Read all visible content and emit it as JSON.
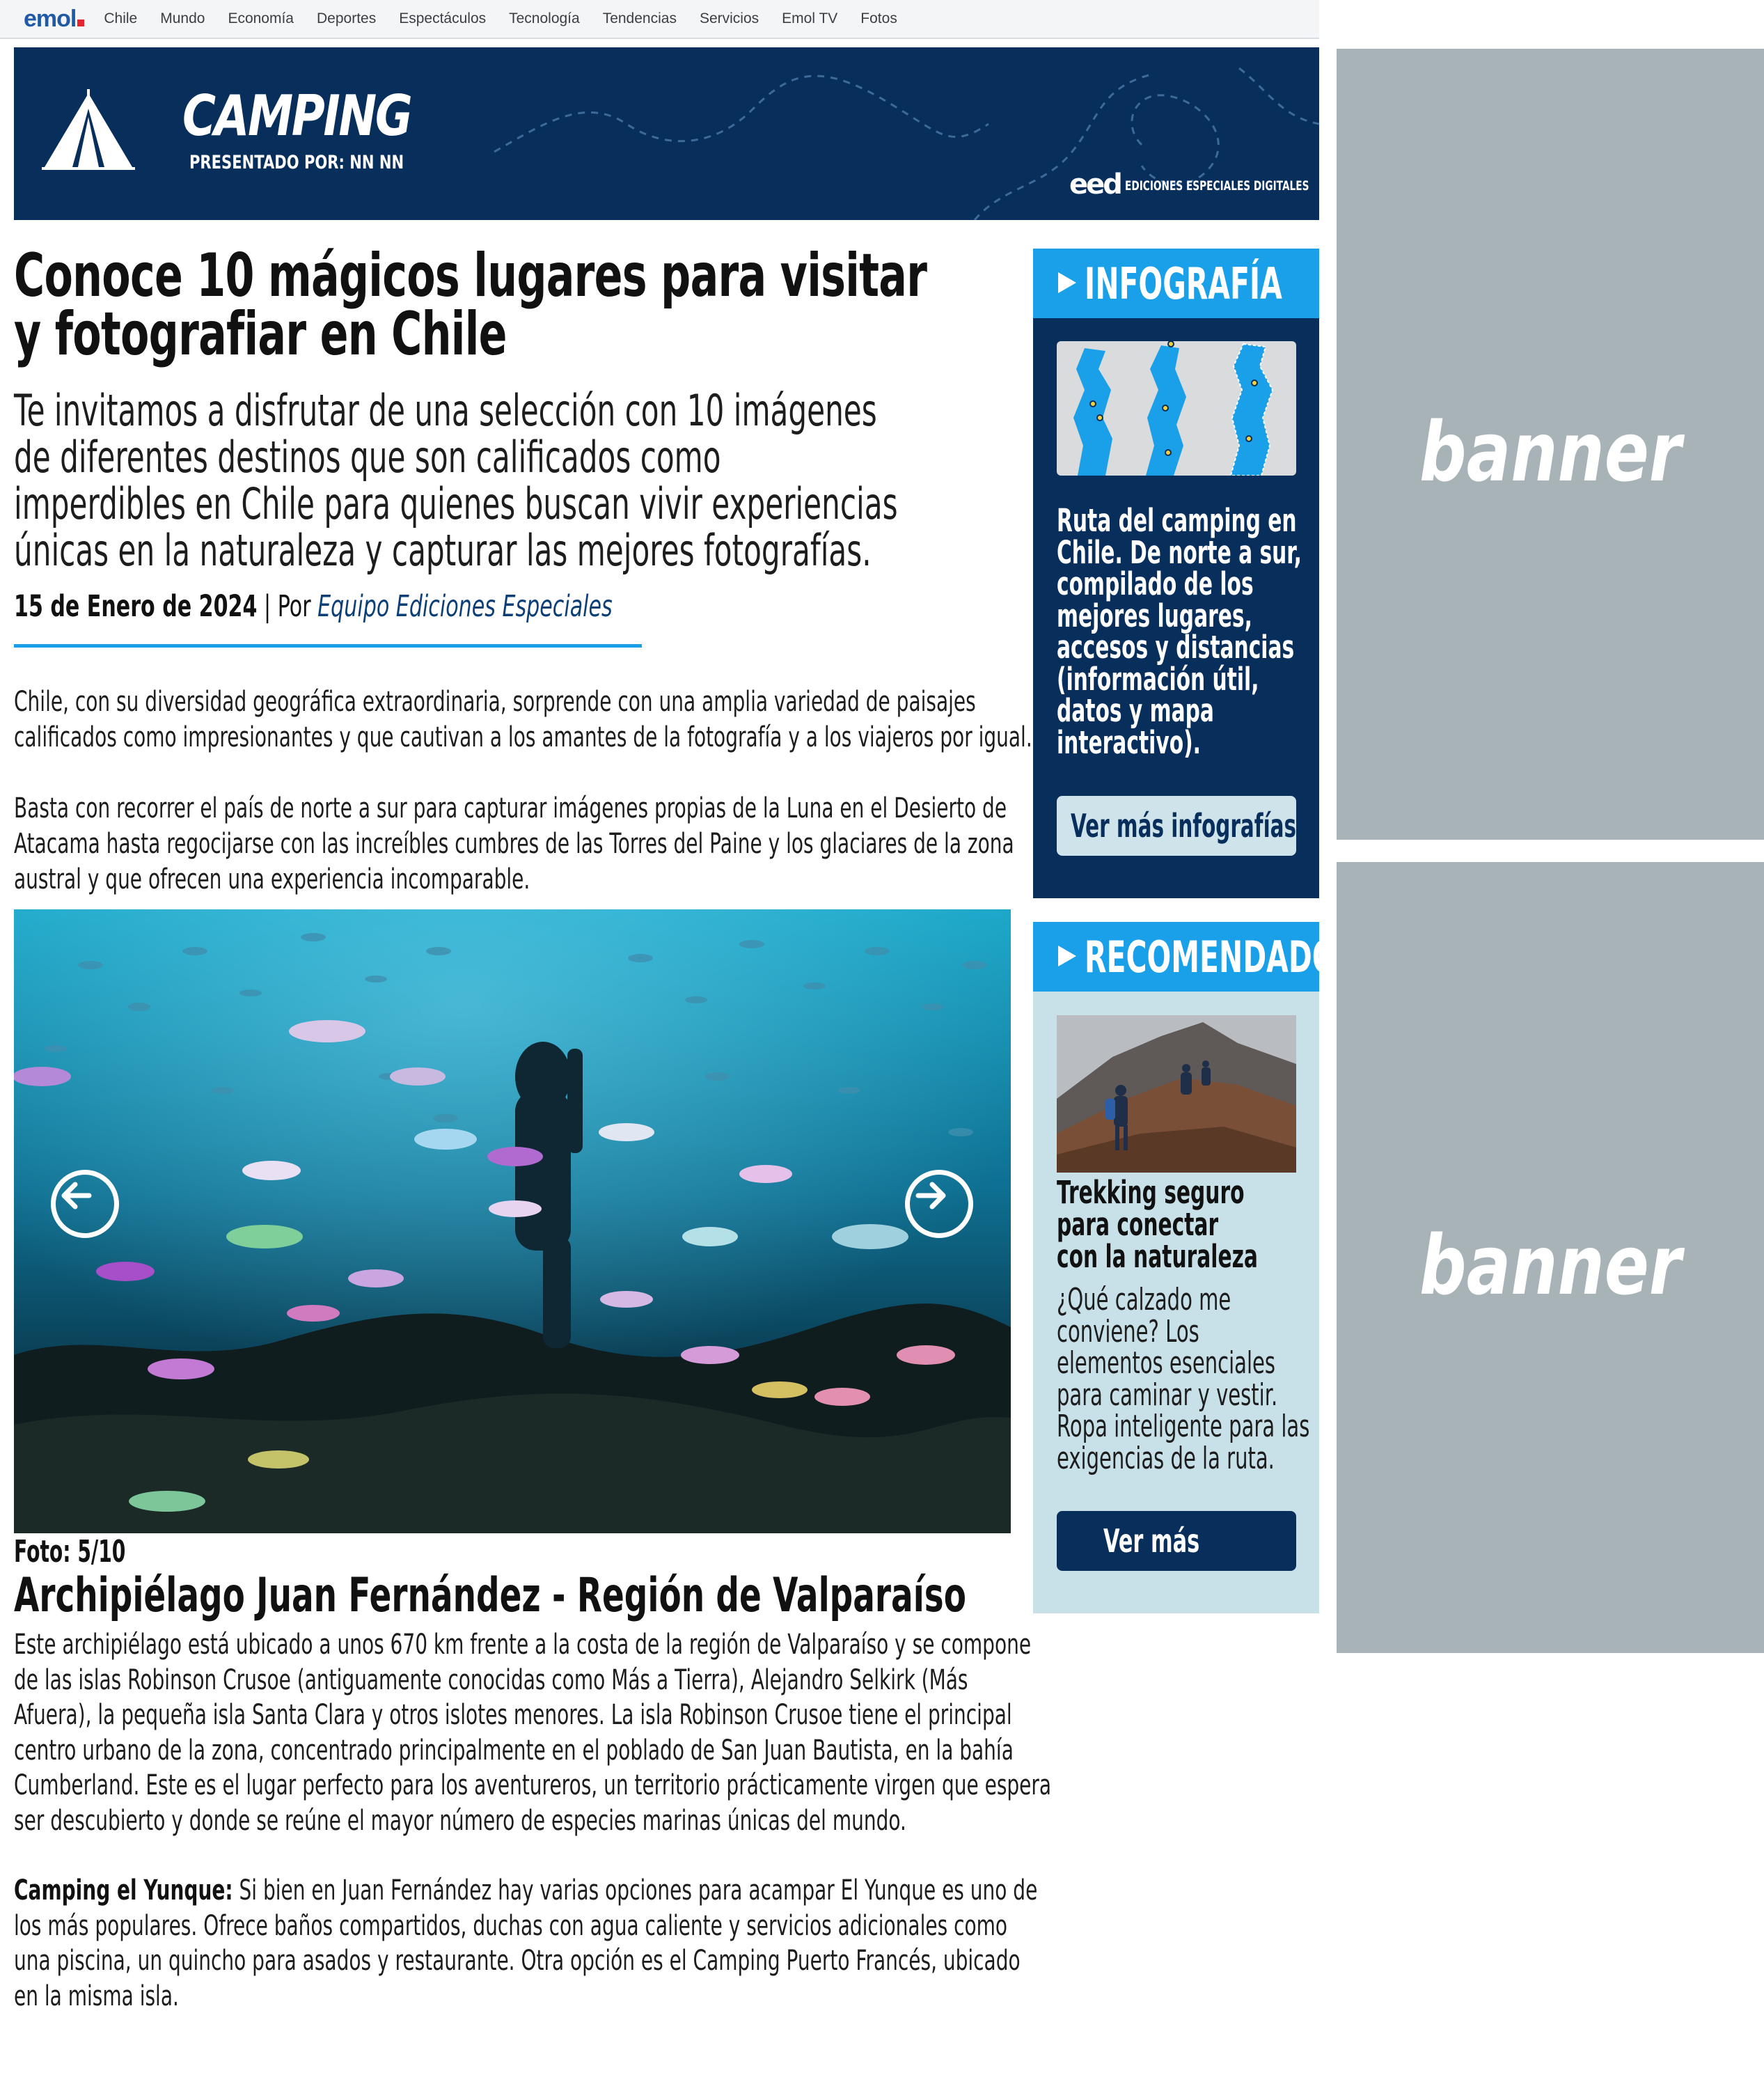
{
  "topnav": {
    "logo": "emol",
    "items": [
      "Chile",
      "Mundo",
      "Economía",
      "Deportes",
      "Espectáculos",
      "Tecnología",
      "Tendencias",
      "Servicios",
      "Emol TV",
      "Fotos"
    ]
  },
  "hero": {
    "section_title": "CAMPING",
    "presented_by": "PRESENTADO POR: NN NN",
    "brand_mark": "eed",
    "brand_text": "EDICIONES ESPECIALES DIGITALES",
    "background_color": "#082e5c"
  },
  "article": {
    "headline_lines": [
      "Conoce 10 mágicos lugares para visitar",
      "y fotografiar en Chile"
    ],
    "dek_lines": [
      "Te invitamos a disfrutar de una selección con 10 imágenes",
      "de diferentes destinos que son calificados como",
      "imperdibles en Chile para quienes buscan vivir experiencias",
      "únicas en la naturaleza y capturar las mejores fotografías."
    ],
    "date": "15 de Enero de 2024",
    "by_prefix": " | Por ",
    "author": "Equipo Ediciones Especiales",
    "intro_p1": [
      "Chile, con su diversidad geográfica extraordinaria, sorprende con una amplia variedad de paisajes",
      "calificados como impresionantes y que cautivan a los amantes de la fotografía y a los viajeros por igual."
    ],
    "intro_p2": [
      "Basta con recorrer el país de norte a sur para capturar imágenes propias de la Luna en el Desierto de",
      "Atacama hasta regocijarse con las increíbles cumbres de las Torres del Paine y los glaciares de la zona",
      "austral y que ofrecen una experiencia incomparable."
    ]
  },
  "gallery": {
    "prev_icon": "arrow-left-icon",
    "next_icon": "arrow-right-icon",
    "counter": "Foto: 5/10",
    "current": 5,
    "total": 10,
    "photo_title": "Archipiélago Juan Fernández - Región de Valparaíso",
    "photo_desc": [
      "Este archipiélago está ubicado a unos 670 km frente a la costa de la región de Valparaíso y se compone",
      "de las islas Robinson Crusoe (antiguamente conocidas como Más a Tierra), Alejandro Selkirk (Más",
      "Afuera), la pequeña isla Santa Clara y otros islotes menores. La isla Robinson Crusoe tiene el principal",
      "centro urbano de la zona, concentrado principalmente en el poblado de San Juan Bautista, en la bahía",
      "Cumberland. Este es el lugar perfecto para los aventureros, un territorio prácticamente virgen que espera",
      "ser descubierto y donde se reúne el mayor número de especies marinas únicas del mundo."
    ],
    "camping_label": "Camping el Yunque:",
    "camping_lines": [
      " Si bien en Juan Fernández hay varias opciones para acampar El Yunque es uno de",
      "los más populares. Ofrece baños compartidos, duchas con agua caliente y servicios adicionales como",
      "una piscina, un quincho para asados y restaurante. Otra opción es el Camping Puerto Francés, ubicado",
      "en la misma isla."
    ]
  },
  "infografia": {
    "heading": "INFOGRAFÍA",
    "text_lines": [
      "Ruta del camping en",
      "Chile. De norte a sur,",
      "compilado de los",
      "mejores lugares,",
      "accesos y distancias",
      "(información útil,",
      "datos y mapa",
      "interactivo)."
    ],
    "button": "Ver más infografías",
    "accent": "#1aa0e8"
  },
  "recomendado": {
    "heading": "RECOMENDADO",
    "title_lines": [
      "Trekking seguro",
      "para conectar",
      "con la naturaleza"
    ],
    "desc_lines": [
      "¿Qué calzado me",
      "conviene? Los",
      "elementos esenciales",
      "para caminar y vestir.",
      "Ropa inteligente para las",
      "exigencias de la ruta."
    ],
    "button": "Ver más"
  },
  "ads": {
    "label_1": "banner",
    "label_2": "banner",
    "color": "#a8b3b8"
  }
}
